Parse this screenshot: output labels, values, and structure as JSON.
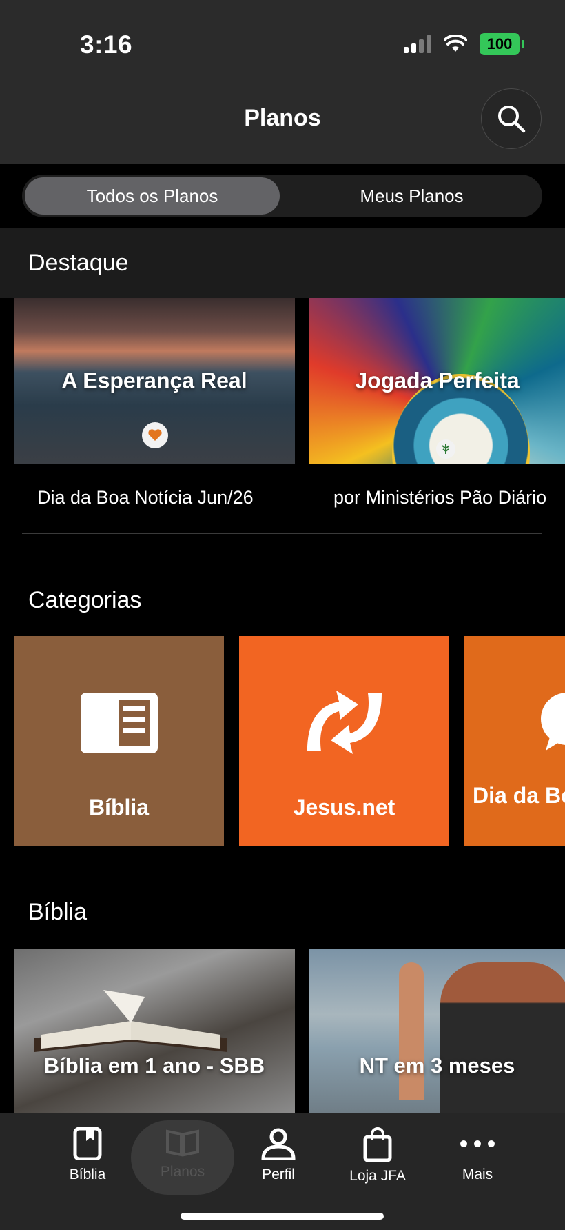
{
  "status_bar": {
    "time": "3:16",
    "battery": "100"
  },
  "header": {
    "title": "Planos"
  },
  "segmented": {
    "all_plans": "Todos os Planos",
    "my_plans": "Meus Planos"
  },
  "featured": {
    "section_title": "Destaque",
    "cards": [
      {
        "title": "A Esperança Real",
        "subtitle": "Dia da Boa Notícia Jun/26"
      },
      {
        "title": "Jogada Perfeita",
        "subtitle": "por Ministérios Pão Diário"
      }
    ]
  },
  "categories": {
    "section_title": "Categorias",
    "tiles": [
      {
        "label": "Bíblia",
        "color": "#8a5e3c"
      },
      {
        "label": "Jesus.net",
        "color": "#f26522"
      },
      {
        "label": "Dia da Boa Notícia",
        "color": "#e06a1b"
      }
    ]
  },
  "biblia": {
    "section_title": "Bíblia",
    "plans": [
      {
        "title": "Bíblia em 1 ano - SBB"
      },
      {
        "title": "NT em 3 meses"
      }
    ]
  },
  "tabbar": {
    "tabs": [
      {
        "label": "Bíblia",
        "icon": "bookmark-book-icon"
      },
      {
        "label": "Planos",
        "icon": "open-book-icon"
      },
      {
        "label": "Perfil",
        "icon": "person-icon"
      },
      {
        "label": "Loja JFA",
        "icon": "shopping-bag-icon"
      },
      {
        "label": "Mais",
        "icon": "more-dots-icon"
      }
    ]
  }
}
